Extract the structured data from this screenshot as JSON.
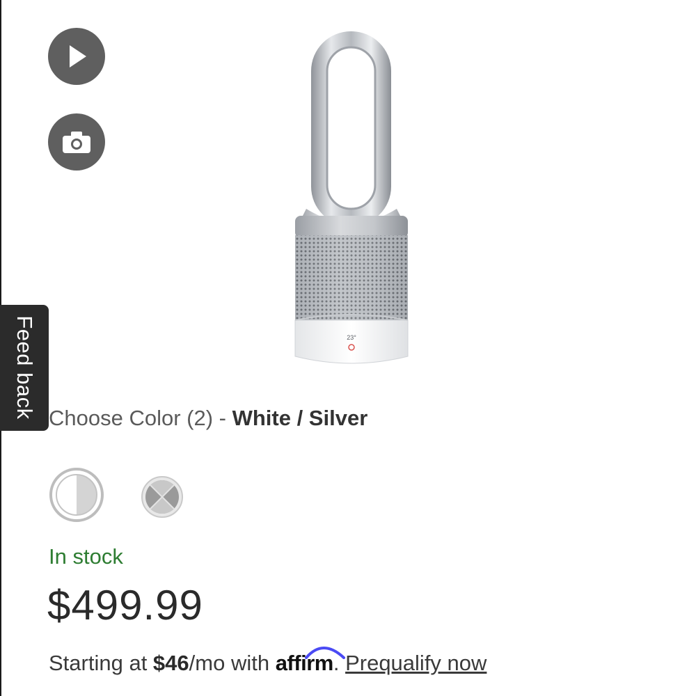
{
  "feedback": {
    "label": "Feed back"
  },
  "media": {
    "play_icon": "play-icon",
    "camera_icon": "camera-icon"
  },
  "product": {
    "display_reading": "23°"
  },
  "color_selector": {
    "prefix": "Choose Color (2) - ",
    "selected": "White / Silver",
    "swatches": [
      {
        "name": "White / Silver",
        "selected": true
      },
      {
        "name": "Iron / Silver",
        "selected": false
      }
    ]
  },
  "availability": {
    "status": "In stock",
    "color": "#2e7d32"
  },
  "price": {
    "amount": "$499.99"
  },
  "financing": {
    "prefix": "Starting at ",
    "amount": "$46",
    "middle": "/mo with ",
    "brand": "affirm",
    "brand_color": "#4a4af4",
    "dot": ".",
    "link": "Prequalify now"
  }
}
